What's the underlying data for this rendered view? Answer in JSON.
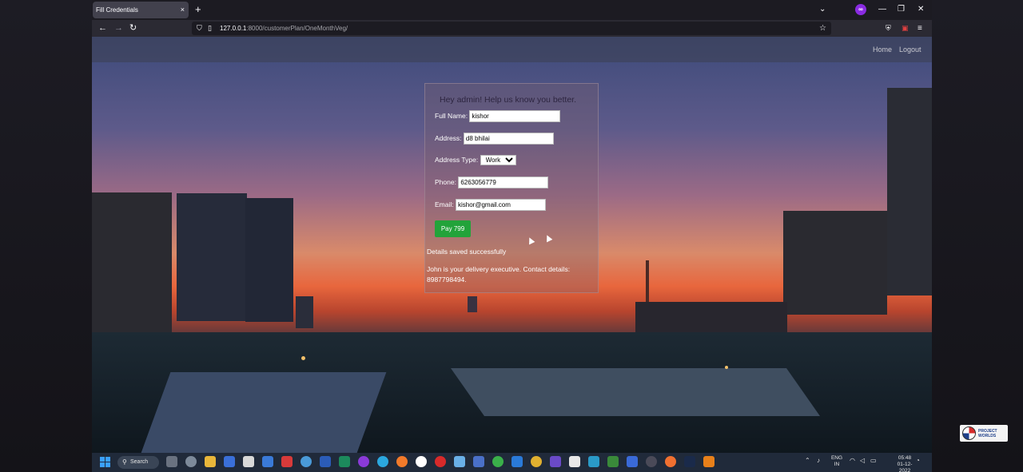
{
  "browser": {
    "tab_title": "Fill Credentials",
    "tab_close": "×",
    "new_tab": "+",
    "url_host": "127.0.0.1",
    "url_rest": ":8000/customerPlan/OneMonthVeg/"
  },
  "nav": {
    "links": [
      "Home",
      "Logout"
    ]
  },
  "form": {
    "title": "Hey admin! Help us know you better.",
    "full_name_label": "Full Name:",
    "full_name_value": "kishor",
    "address_label": "Address:",
    "address_value": "d8 bhilai",
    "address_type_label": "Address Type:",
    "address_type_value": "Work",
    "phone_label": "Phone:",
    "phone_value": "6263056779",
    "email_label": "Email:",
    "email_value": "kishor@gmail.com",
    "pay_button": "Pay 799",
    "success_message": "Details saved successfully",
    "delivery_message": "John is your delivery executive. Contact details: 8987798494."
  },
  "taskbar": {
    "search_label": "Search",
    "language": "ENG",
    "region": "IN",
    "time": "05:48",
    "date": "01-12-2022"
  },
  "watermark": {
    "text": "PROJECT WORLDS"
  },
  "colors": {
    "pay_button": "#22a33a",
    "browser_chrome": "#1c1b22",
    "taskbar": "#202a3a"
  }
}
